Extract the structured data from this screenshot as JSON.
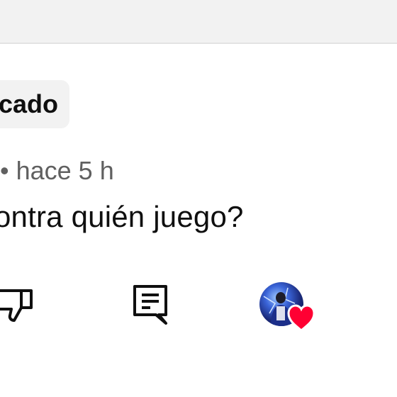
{
  "header": {
    "background": "#f2f2f2"
  },
  "comment": {
    "badge_label": "cado",
    "meta_prefix": "•",
    "time": "• hace 5 h",
    "text": "ontra quién juego?"
  },
  "actions": {
    "dislike_icon": "thumbs-down-icon",
    "reply_icon": "comment-icon",
    "creator_heart_icon": "creator-heart-icon",
    "heart_color": "#ff0033"
  }
}
